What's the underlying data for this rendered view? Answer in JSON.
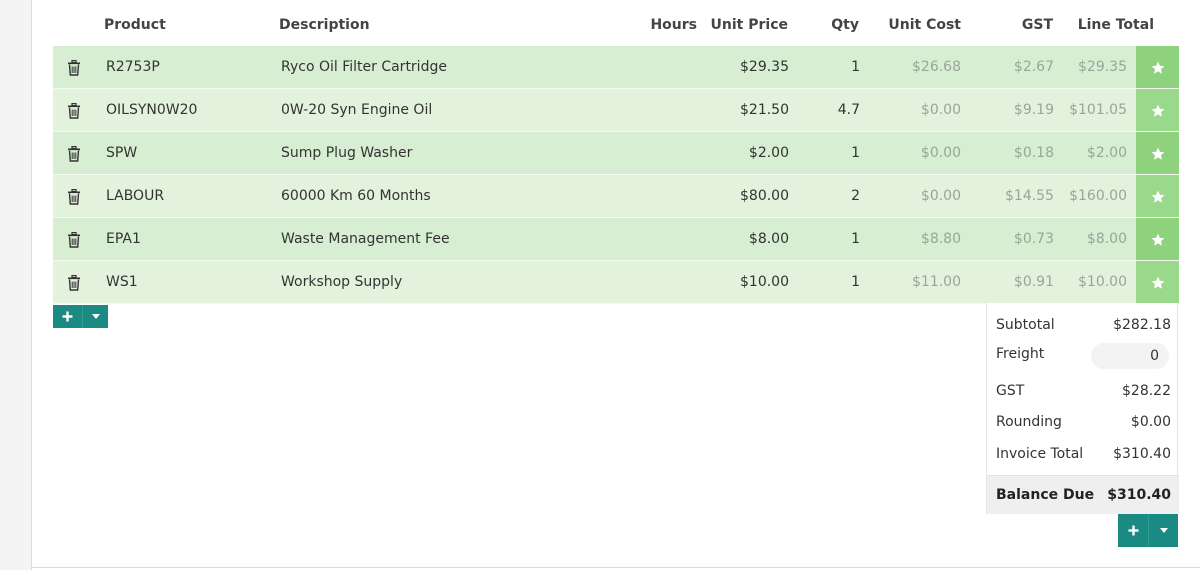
{
  "columns": {
    "product": "Product",
    "description": "Description",
    "hours": "Hours",
    "unit_price": "Unit Price",
    "qty": "Qty",
    "unit_cost": "Unit Cost",
    "gst": "GST",
    "line_total": "Line Total"
  },
  "rows": [
    {
      "product": "R2753P",
      "description": "Ryco Oil Filter Cartridge",
      "hours": "",
      "unit_price": "$29.35",
      "qty": "1",
      "unit_cost": "$26.68",
      "gst": "$2.67",
      "line_total": "$29.35"
    },
    {
      "product": "OILSYN0W20",
      "description": "0W-20 Syn Engine Oil",
      "hours": "",
      "unit_price": "$21.50",
      "qty": "4.7",
      "unit_cost": "$0.00",
      "gst": "$9.19",
      "line_total": "$101.05"
    },
    {
      "product": "SPW",
      "description": "Sump Plug Washer",
      "hours": "",
      "unit_price": "$2.00",
      "qty": "1",
      "unit_cost": "$0.00",
      "gst": "$0.18",
      "line_total": "$2.00"
    },
    {
      "product": "LABOUR",
      "description": "60000 Km 60 Months",
      "hours": "",
      "unit_price": "$80.00",
      "qty": "2",
      "unit_cost": "$0.00",
      "gst": "$14.55",
      "line_total": "$160.00"
    },
    {
      "product": "EPA1",
      "description": "Waste Management Fee",
      "hours": "",
      "unit_price": "$8.00",
      "qty": "1",
      "unit_cost": "$8.80",
      "gst": "$0.73",
      "line_total": "$8.00"
    },
    {
      "product": "WS1",
      "description": "Workshop Supply",
      "hours": "",
      "unit_price": "$10.00",
      "qty": "1",
      "unit_cost": "$11.00",
      "gst": "$0.91",
      "line_total": "$10.00"
    }
  ],
  "totals": {
    "subtotal_label": "Subtotal",
    "subtotal_value": "$282.18",
    "freight_label": "Freight",
    "freight_value": "0",
    "gst_label": "GST",
    "gst_value": "$28.22",
    "rounding_label": "Rounding",
    "rounding_value": "$0.00",
    "invoice_total_label": "Invoice Total",
    "invoice_total_value": "$310.40",
    "balance_due_label": "Balance Due",
    "balance_due_value": "$310.40"
  },
  "icons": {
    "delete": "trash-icon",
    "favorite": "star-icon",
    "add": "plus-icon",
    "dropdown": "caret-down-icon"
  },
  "colors": {
    "row_odd": "#d8eed2",
    "row_even": "#e3f2dd",
    "star_cell": "#8ed27e",
    "button": "#1b8a82"
  }
}
